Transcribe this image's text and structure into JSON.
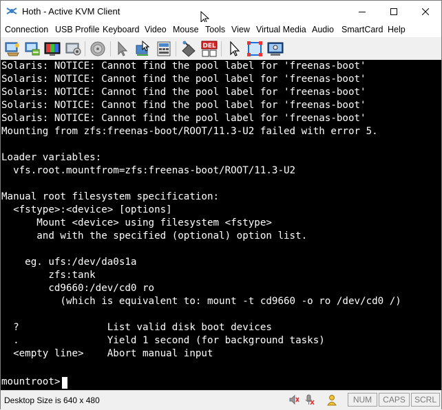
{
  "window": {
    "title": "Hoth - Active KVM Client"
  },
  "menu": {
    "items": [
      "Connection",
      "USB Profile",
      "Keyboard",
      "Video",
      "Mouse",
      "Tools",
      "View",
      "Virtual Media",
      "Audio",
      "SmartCard",
      "Help"
    ]
  },
  "toolbar": {
    "icons": [
      "connection-properties-icon",
      "usb-profile-icon",
      "video-settings-icon",
      "auto-adjust-icon",
      "audio-icon",
      "single-cursor-icon",
      "align-mouse-icon",
      "keyboard-macros-icon",
      "refresh-icon",
      "ctrl-alt-del-icon",
      "mouse-pointer-icon",
      "full-screen-icon",
      "screenshot-icon"
    ],
    "del_label": "DEL"
  },
  "console": {
    "lines": [
      "Solaris: NOTICE: Cannot find the pool label for 'freenas-boot'",
      "Solaris: NOTICE: Cannot find the pool label for 'freenas-boot'",
      "Solaris: NOTICE: Cannot find the pool label for 'freenas-boot'",
      "Solaris: NOTICE: Cannot find the pool label for 'freenas-boot'",
      "Solaris: NOTICE: Cannot find the pool label for 'freenas-boot'",
      "Mounting from zfs:freenas-boot/ROOT/11.3-U2 failed with error 5.",
      "",
      "Loader variables:",
      "  vfs.root.mountfrom=zfs:freenas-boot/ROOT/11.3-U2",
      "",
      "Manual root filesystem specification:",
      "  <fstype>:<device> [options]",
      "      Mount <device> using filesystem <fstype>",
      "      and with the specified (optional) option list.",
      "",
      "    eg. ufs:/dev/da0s1a",
      "        zfs:tank",
      "        cd9660:/dev/cd0 ro",
      "          (which is equivalent to: mount -t cd9660 -o ro /dev/cd0 /)",
      "",
      "  ?               List valid disk boot devices",
      "  .               Yield 1 second (for background tasks)",
      "  <empty line>    Abort manual input",
      "",
      "mountroot> "
    ]
  },
  "status": {
    "desktop_size": "Desktop Size is 640 x 480",
    "num": "NUM",
    "caps": "CAPS",
    "scrl": "SCRL"
  }
}
